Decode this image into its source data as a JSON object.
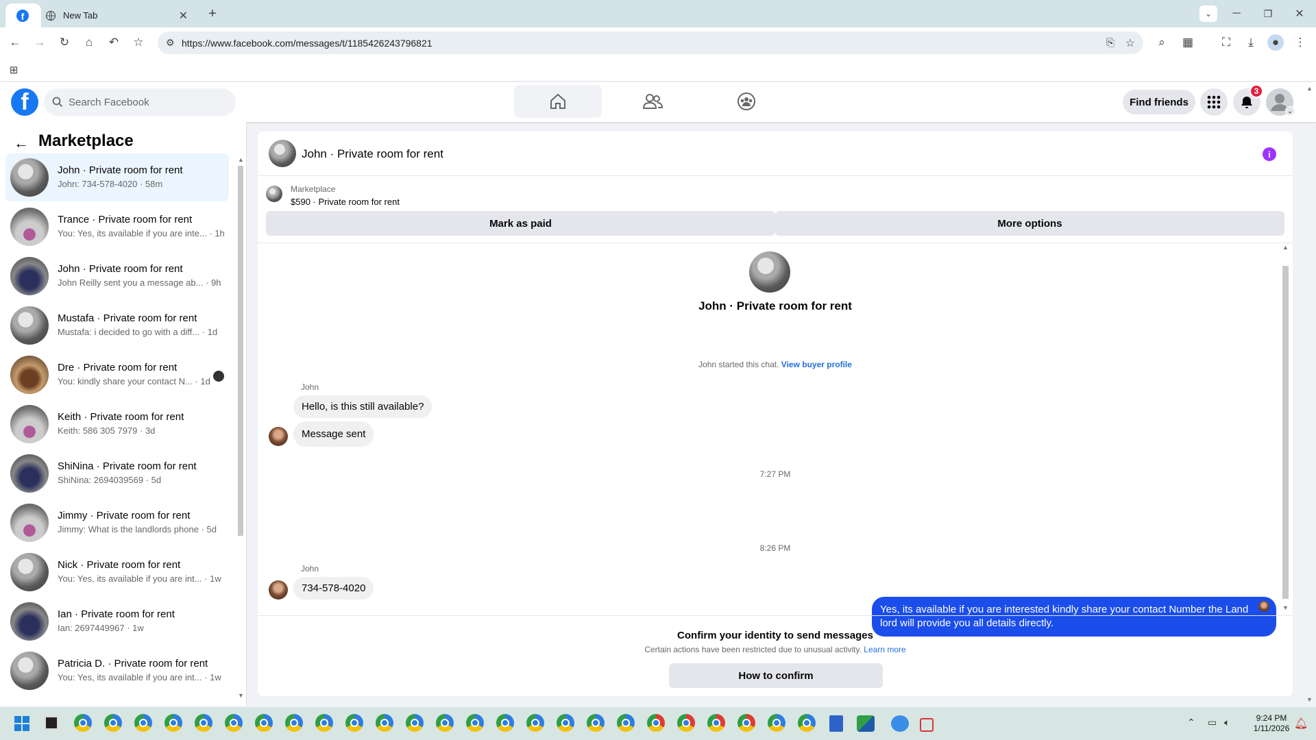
{
  "browser": {
    "tab_title": "New Tab",
    "url": "https://www.facebook.com/messages/t/1185426243796821"
  },
  "header": {
    "search_placeholder": "Search Facebook",
    "find_friends": "Find friends",
    "notification_count": "3"
  },
  "sidebar": {
    "title": "Marketplace",
    "conversations": [
      {
        "title": "John · Private room for rent",
        "preview": "John: 734-578-4020 · 58m",
        "thumb": "room",
        "active": true
      },
      {
        "title": "Trance · Private room for rent",
        "preview": "You: Yes, its available if you are inte... · 1h",
        "thumb": "room2"
      },
      {
        "title": "John · Private room for rent",
        "preview": "John Reilly sent you a message ab... · 9h",
        "thumb": "room3"
      },
      {
        "title": "Mustafa · Private room for rent",
        "preview": "Mustafa: i decided to go with a diff... · 1d",
        "thumb": "room"
      },
      {
        "title": "Dre · Private room for rent",
        "preview": "You: kindly share your contact N... · 1d",
        "thumb": "room4"
      },
      {
        "title": "Keith · Private room for rent",
        "preview": "Keith: 586 305 7979 · 3d",
        "thumb": "room2"
      },
      {
        "title": "ShiNina · Private room for rent",
        "preview": "ShiNina: 2694039569 · 5d",
        "thumb": "room3"
      },
      {
        "title": "Jimmy · Private room for rent",
        "preview": "Jimmy: What is the landlords phone · 5d",
        "thumb": "room2"
      },
      {
        "title": "Nick · Private room for rent",
        "preview": "You: Yes, its available if you are int... · 1w",
        "thumb": "room"
      },
      {
        "title": "Ian · Private room for rent",
        "preview": "Ian: 2697449967 · 1w",
        "thumb": "room3"
      },
      {
        "title": "Patricia D. · Private room for rent",
        "preview": "You: Yes, its available if you are int... · 1w",
        "thumb": "room"
      }
    ]
  },
  "chat": {
    "header_title": "John · Private room for rent",
    "listing_source": "Marketplace",
    "listing_title": "$590 · Private room for rent",
    "mark_paid": "Mark as paid",
    "more_options": "More options",
    "profile_title": "John · Private room for rent",
    "started_text": "John started this chat.",
    "view_buyer": "View buyer profile",
    "msg_sender_1": "John",
    "msg_1": "Hello, is this still available?",
    "msg_2": "Message sent",
    "time_1": "7:27 PM",
    "outgoing": "Yes, its available if you are interested kindly share your contact Number the Land lord will provide you all details directly.",
    "time_2": "8:26 PM",
    "msg_sender_2": "John",
    "msg_3": "734-578-4020",
    "confirm_title": "Confirm your identity to send messages",
    "confirm_sub": "Certain actions have been restricted due to unusual activity.",
    "learn_more": "Learn more",
    "how_confirm": "How to confirm"
  },
  "taskbar": {
    "time": "9:24 PM",
    "date": "1/11/2026"
  },
  "colors": {
    "fb_blue": "#1877f2",
    "outgoing_bubble": "#1b4dea",
    "badge_red": "#e41e3f",
    "info_purple": "#a033ff"
  }
}
